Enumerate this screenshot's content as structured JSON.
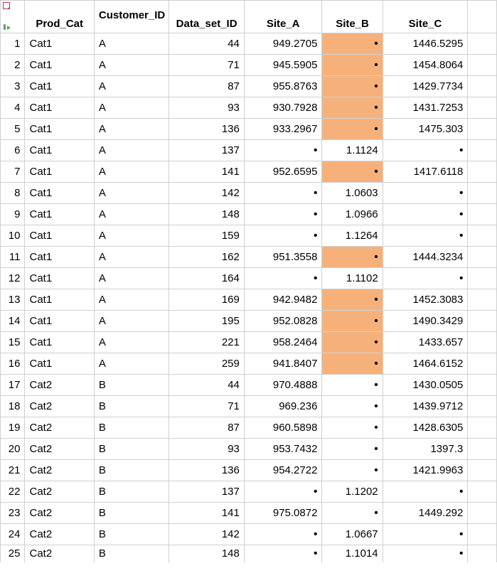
{
  "columns": {
    "prod_cat": "Prod_Cat",
    "customer_id": "Customer_ID",
    "data_set_id": "Data_set_ID",
    "site_a": "Site_A",
    "site_b": "Site_B",
    "site_c": "Site_C"
  },
  "dot": "•",
  "rows": [
    {
      "n": "1",
      "prod_cat": "Cat1",
      "cust": "A",
      "ds": "44",
      "a": "949.2705",
      "b_dot": true,
      "b_hl": true,
      "c": "1446.5295"
    },
    {
      "n": "2",
      "prod_cat": "Cat1",
      "cust": "A",
      "ds": "71",
      "a": "945.5905",
      "b_dot": true,
      "b_hl": true,
      "c": "1454.8064"
    },
    {
      "n": "3",
      "prod_cat": "Cat1",
      "cust": "A",
      "ds": "87",
      "a": "955.8763",
      "b_dot": true,
      "b_hl": true,
      "c": "1429.7734"
    },
    {
      "n": "4",
      "prod_cat": "Cat1",
      "cust": "A",
      "ds": "93",
      "a": "930.7928",
      "b_dot": true,
      "b_hl": true,
      "c": "1431.7253"
    },
    {
      "n": "5",
      "prod_cat": "Cat1",
      "cust": "A",
      "ds": "136",
      "a": "933.2967",
      "b_dot": true,
      "b_hl": true,
      "c": "1475.303"
    },
    {
      "n": "6",
      "prod_cat": "Cat1",
      "cust": "A",
      "ds": "137",
      "a_dot": true,
      "b": "1.1124",
      "c_dot": true
    },
    {
      "n": "7",
      "prod_cat": "Cat1",
      "cust": "A",
      "ds": "141",
      "a": "952.6595",
      "b_dot": true,
      "b_hl": true,
      "c": "1417.6118"
    },
    {
      "n": "8",
      "prod_cat": "Cat1",
      "cust": "A",
      "ds": "142",
      "a_dot": true,
      "b": "1.0603",
      "c_dot": true
    },
    {
      "n": "9",
      "prod_cat": "Cat1",
      "cust": "A",
      "ds": "148",
      "a_dot": true,
      "b": "1.0966",
      "c_dot": true
    },
    {
      "n": "10",
      "prod_cat": "Cat1",
      "cust": "A",
      "ds": "159",
      "a_dot": true,
      "b": "1.1264",
      "c_dot": true
    },
    {
      "n": "11",
      "prod_cat": "Cat1",
      "cust": "A",
      "ds": "162",
      "a": "951.3558",
      "b_dot": true,
      "b_hl": true,
      "c": "1444.3234"
    },
    {
      "n": "12",
      "prod_cat": "Cat1",
      "cust": "A",
      "ds": "164",
      "a_dot": true,
      "b": "1.1102",
      "c_dot": true
    },
    {
      "n": "13",
      "prod_cat": "Cat1",
      "cust": "A",
      "ds": "169",
      "a": "942.9482",
      "b_dot": true,
      "b_hl": true,
      "c": "1452.3083"
    },
    {
      "n": "14",
      "prod_cat": "Cat1",
      "cust": "A",
      "ds": "195",
      "a": "952.0828",
      "b_dot": true,
      "b_hl": true,
      "c": "1490.3429"
    },
    {
      "n": "15",
      "prod_cat": "Cat1",
      "cust": "A",
      "ds": "221",
      "a": "958.2464",
      "b_dot": true,
      "b_hl": true,
      "c": "1433.657"
    },
    {
      "n": "16",
      "prod_cat": "Cat1",
      "cust": "A",
      "ds": "259",
      "a": "941.8407",
      "b_dot": true,
      "b_hl": true,
      "c": "1464.6152"
    },
    {
      "n": "17",
      "prod_cat": "Cat2",
      "cust": "B",
      "ds": "44",
      "a": "970.4888",
      "b_dot": true,
      "c": "1430.0505"
    },
    {
      "n": "18",
      "prod_cat": "Cat2",
      "cust": "B",
      "ds": "71",
      "a": "969.236",
      "b_dot": true,
      "c": "1439.9712"
    },
    {
      "n": "19",
      "prod_cat": "Cat2",
      "cust": "B",
      "ds": "87",
      "a": "960.5898",
      "b_dot": true,
      "c": "1428.6305"
    },
    {
      "n": "20",
      "prod_cat": "Cat2",
      "cust": "B",
      "ds": "93",
      "a": "953.7432",
      "b_dot": true,
      "c": "1397.3"
    },
    {
      "n": "21",
      "prod_cat": "Cat2",
      "cust": "B",
      "ds": "136",
      "a": "954.2722",
      "b_dot": true,
      "c": "1421.9963"
    },
    {
      "n": "22",
      "prod_cat": "Cat2",
      "cust": "B",
      "ds": "137",
      "a_dot": true,
      "b": "1.1202",
      "c_dot": true
    },
    {
      "n": "23",
      "prod_cat": "Cat2",
      "cust": "B",
      "ds": "141",
      "a": "975.0872",
      "b_dot": true,
      "c": "1449.292"
    },
    {
      "n": "24",
      "prod_cat": "Cat2",
      "cust": "B",
      "ds": "142",
      "a_dot": true,
      "b": "1.0667",
      "c_dot": true
    },
    {
      "n": "25",
      "prod_cat": "Cat2",
      "cust": "B",
      "ds": "148",
      "a_dot": true,
      "b": "1.1014",
      "c_dot": true
    }
  ]
}
